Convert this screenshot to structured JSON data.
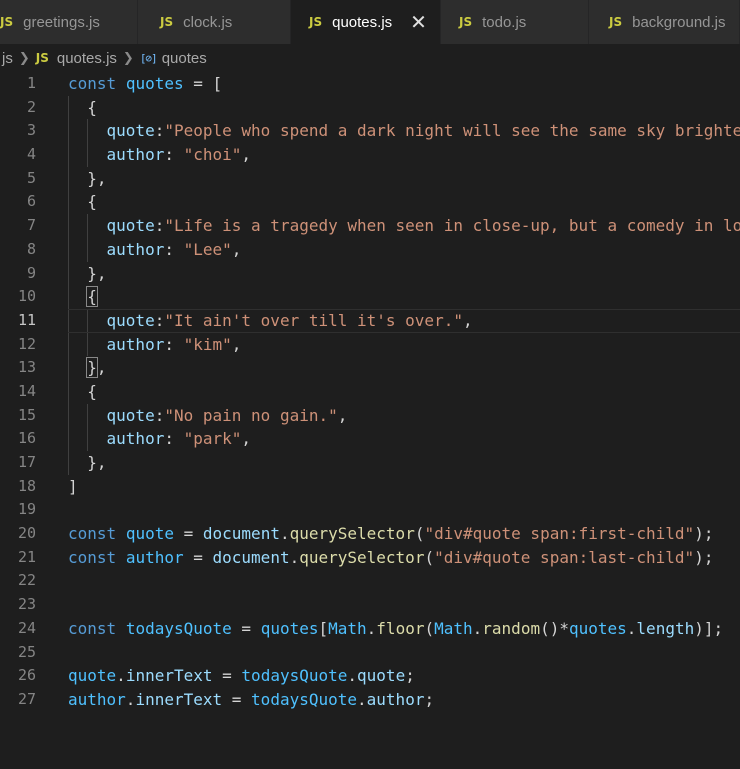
{
  "tabs": [
    {
      "label": "greetings.js",
      "icon": "JS",
      "active": false
    },
    {
      "label": "clock.js",
      "icon": "JS",
      "active": false
    },
    {
      "label": "quotes.js",
      "icon": "JS",
      "active": true,
      "close": "✕"
    },
    {
      "label": "todo.js",
      "icon": "JS",
      "active": false
    },
    {
      "label": "background.js",
      "icon": "JS",
      "active": false
    }
  ],
  "breadcrumb": {
    "folder": "js",
    "file_icon": "JS",
    "file": "quotes.js",
    "symbol_icon": "[⊘]",
    "symbol": "quotes"
  },
  "editor": {
    "current_line": 11,
    "lines": [
      {
        "n": "1",
        "tokens": [
          [
            "const",
            "kw"
          ],
          [
            " ",
            "def"
          ],
          [
            "quotes",
            "var"
          ],
          [
            " = [",
            "def"
          ]
        ]
      },
      {
        "n": "2",
        "tokens": [
          [
            "  {",
            "def"
          ]
        ]
      },
      {
        "n": "3",
        "tokens": [
          [
            "    ",
            "def"
          ],
          [
            "quote",
            "prop"
          ],
          [
            ":",
            "def"
          ],
          [
            "\"People who spend a dark night will see the same sky brighte",
            "str"
          ]
        ]
      },
      {
        "n": "4",
        "tokens": [
          [
            "    ",
            "def"
          ],
          [
            "author",
            "prop"
          ],
          [
            ": ",
            "def"
          ],
          [
            "\"choi\"",
            "str"
          ],
          [
            ",",
            "def"
          ]
        ]
      },
      {
        "n": "5",
        "tokens": [
          [
            "  },",
            "def"
          ]
        ]
      },
      {
        "n": "6",
        "tokens": [
          [
            "  {",
            "def"
          ]
        ]
      },
      {
        "n": "7",
        "tokens": [
          [
            "    ",
            "def"
          ],
          [
            "quote",
            "prop"
          ],
          [
            ":",
            "def"
          ],
          [
            "\"Life is a tragedy when seen in close-up, but a comedy in lo",
            "str"
          ]
        ]
      },
      {
        "n": "8",
        "tokens": [
          [
            "    ",
            "def"
          ],
          [
            "author",
            "prop"
          ],
          [
            ": ",
            "def"
          ],
          [
            "\"Lee\"",
            "str"
          ],
          [
            ",",
            "def"
          ]
        ]
      },
      {
        "n": "9",
        "tokens": [
          [
            "  },",
            "def"
          ]
        ]
      },
      {
        "n": "10",
        "tokens": [
          [
            "  ",
            "def"
          ],
          [
            "{",
            "bm"
          ]
        ]
      },
      {
        "n": "11",
        "tokens": [
          [
            "    ",
            "def"
          ],
          [
            "quote",
            "prop"
          ],
          [
            ":",
            "def"
          ],
          [
            "\"It ain't over till it's over.\"",
            "str"
          ],
          [
            ",",
            "def"
          ]
        ]
      },
      {
        "n": "12",
        "tokens": [
          [
            "    ",
            "def"
          ],
          [
            "author",
            "prop"
          ],
          [
            ": ",
            "def"
          ],
          [
            "\"kim\"",
            "str"
          ],
          [
            ",",
            "def"
          ]
        ]
      },
      {
        "n": "13",
        "tokens": [
          [
            "  ",
            "def"
          ],
          [
            "}",
            "bm"
          ],
          [
            ",",
            "def"
          ]
        ]
      },
      {
        "n": "14",
        "tokens": [
          [
            "  {",
            "def"
          ]
        ]
      },
      {
        "n": "15",
        "tokens": [
          [
            "    ",
            "def"
          ],
          [
            "quote",
            "prop"
          ],
          [
            ":",
            "def"
          ],
          [
            "\"No pain no gain.\"",
            "str"
          ],
          [
            ",",
            "def"
          ]
        ]
      },
      {
        "n": "16",
        "tokens": [
          [
            "    ",
            "def"
          ],
          [
            "author",
            "prop"
          ],
          [
            ": ",
            "def"
          ],
          [
            "\"park\"",
            "str"
          ],
          [
            ",",
            "def"
          ]
        ]
      },
      {
        "n": "17",
        "tokens": [
          [
            "  },",
            "def"
          ]
        ]
      },
      {
        "n": "18",
        "tokens": [
          [
            "]",
            "def"
          ]
        ]
      },
      {
        "n": "19",
        "tokens": []
      },
      {
        "n": "20",
        "tokens": [
          [
            "const",
            "kw"
          ],
          [
            " ",
            "def"
          ],
          [
            "quote",
            "var"
          ],
          [
            " = ",
            "def"
          ],
          [
            "document",
            "prop"
          ],
          [
            ".",
            "def"
          ],
          [
            "querySelector",
            "fn"
          ],
          [
            "(",
            "def"
          ],
          [
            "\"div#quote span:first-child\"",
            "str"
          ],
          [
            ");",
            "def"
          ]
        ]
      },
      {
        "n": "21",
        "tokens": [
          [
            "const",
            "kw"
          ],
          [
            " ",
            "def"
          ],
          [
            "author",
            "var"
          ],
          [
            " = ",
            "def"
          ],
          [
            "document",
            "prop"
          ],
          [
            ".",
            "def"
          ],
          [
            "querySelector",
            "fn"
          ],
          [
            "(",
            "def"
          ],
          [
            "\"div#quote span:last-child\"",
            "str"
          ],
          [
            ");",
            "def"
          ]
        ]
      },
      {
        "n": "22",
        "tokens": []
      },
      {
        "n": "23",
        "tokens": []
      },
      {
        "n": "24",
        "tokens": [
          [
            "const",
            "kw"
          ],
          [
            " ",
            "def"
          ],
          [
            "todaysQuote",
            "var"
          ],
          [
            " = ",
            "def"
          ],
          [
            "quotes",
            "var"
          ],
          [
            "[",
            "def"
          ],
          [
            "Math",
            "var"
          ],
          [
            ".",
            "def"
          ],
          [
            "floor",
            "fn"
          ],
          [
            "(",
            "def"
          ],
          [
            "Math",
            "var"
          ],
          [
            ".",
            "def"
          ],
          [
            "random",
            "fn"
          ],
          [
            "()*",
            "def"
          ],
          [
            "quotes",
            "var"
          ],
          [
            ".",
            "def"
          ],
          [
            "length",
            "prop"
          ],
          [
            ")];",
            "def"
          ]
        ]
      },
      {
        "n": "25",
        "tokens": []
      },
      {
        "n": "26",
        "tokens": [
          [
            "quote",
            "var"
          ],
          [
            ".",
            "def"
          ],
          [
            "innerText",
            "prop"
          ],
          [
            " = ",
            "def"
          ],
          [
            "todaysQuote",
            "var"
          ],
          [
            ".",
            "def"
          ],
          [
            "quote",
            "prop"
          ],
          [
            ";",
            "def"
          ]
        ]
      },
      {
        "n": "27",
        "tokens": [
          [
            "author",
            "var"
          ],
          [
            ".",
            "def"
          ],
          [
            "innerText",
            "prop"
          ],
          [
            " = ",
            "def"
          ],
          [
            "todaysQuote",
            "var"
          ],
          [
            ".",
            "def"
          ],
          [
            "author",
            "prop"
          ],
          [
            ";",
            "def"
          ]
        ]
      }
    ]
  }
}
